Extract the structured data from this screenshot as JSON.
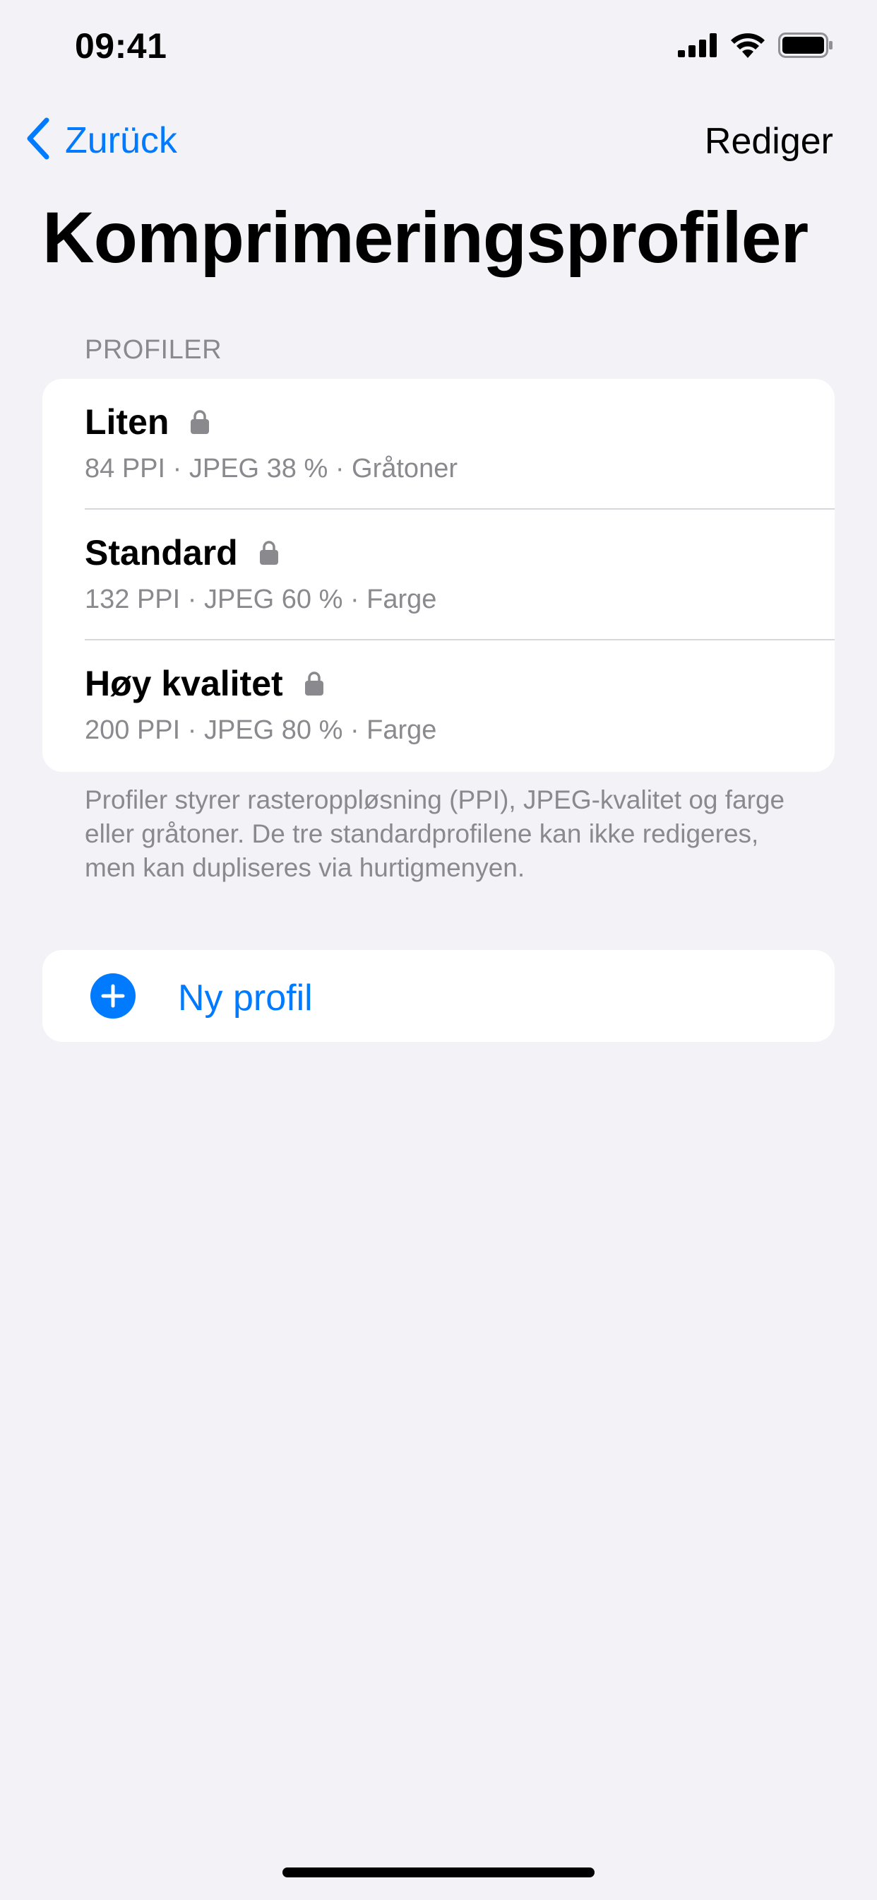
{
  "status_bar": {
    "time": "09:41"
  },
  "nav": {
    "back_label": "Zurück",
    "edit_label": "Rediger"
  },
  "page": {
    "title": "Komprimeringsprofiler"
  },
  "profiles_section": {
    "header": "PROFILER",
    "items": [
      {
        "name": "Liten",
        "detail": "84 PPI · JPEG 38 % · Gråtoner",
        "locked": true
      },
      {
        "name": "Standard",
        "detail": "132 PPI · JPEG 60 % · Farge",
        "locked": true
      },
      {
        "name": "Høy kvalitet",
        "detail": "200 PPI · JPEG 80 % · Farge",
        "locked": true
      }
    ],
    "footer": "Profiler styrer rasteroppløsning (PPI), JPEG-kvalitet og farge eller gråtoner. De tre standardprofilene kan ikke redigeres, men kan dupliseres via hurtigmenyen."
  },
  "new_profile": {
    "label": "Ny profil",
    "icon": "plus-circle-icon"
  },
  "icons": {
    "back": "chevron-left-icon",
    "lock": "lock-icon",
    "signal": "cellular-signal-icon",
    "wifi": "wifi-icon",
    "battery": "battery-icon"
  },
  "colors": {
    "accent": "#007aff",
    "background": "#f2f2f7",
    "secondary_text": "#8a8a8e",
    "lock": "#8a8a8e"
  }
}
